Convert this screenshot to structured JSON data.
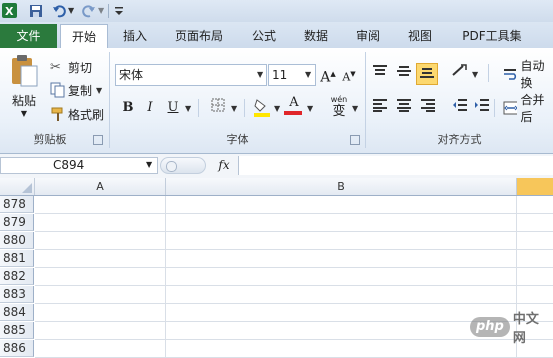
{
  "qat": {
    "icons": [
      "excel-logo-icon",
      "save-icon",
      "undo-icon",
      "redo-icon",
      "customize-icon"
    ]
  },
  "tabs": {
    "file": "文件",
    "home": "开始",
    "insert": "插入",
    "page_layout": "页面布局",
    "formulas": "公式",
    "data": "数据",
    "review": "审阅",
    "view": "视图",
    "pdf_tools": "PDF工具集"
  },
  "clipboard": {
    "paste": "粘贴",
    "cut": "剪切",
    "copy": "复制",
    "format_painter": "格式刷",
    "group_label": "剪贴板"
  },
  "font": {
    "name": "宋体",
    "size": "11",
    "bold": "B",
    "italic": "I",
    "underline": "U",
    "grow": "A",
    "shrink": "A",
    "phonetic": "wén",
    "phonetic_char": "变",
    "group_label": "字体"
  },
  "alignment": {
    "wrap_text": "自动换",
    "merge": "合并后",
    "group_label": "对齐方式"
  },
  "formula_bar": {
    "name_box": "C894",
    "fx": "fx",
    "formula": ""
  },
  "sheet": {
    "columns": [
      "A",
      "B",
      ""
    ],
    "rows": [
      "878",
      "879",
      "880",
      "881",
      "882",
      "883",
      "884",
      "885",
      "886"
    ]
  },
  "watermark": {
    "logo": "php",
    "text": "中文网"
  },
  "colors": {
    "file_tab": "#2b7a3d",
    "highlight": "#ffe600",
    "font_color": "#e0262a",
    "selected_col": "#f7c65a"
  }
}
